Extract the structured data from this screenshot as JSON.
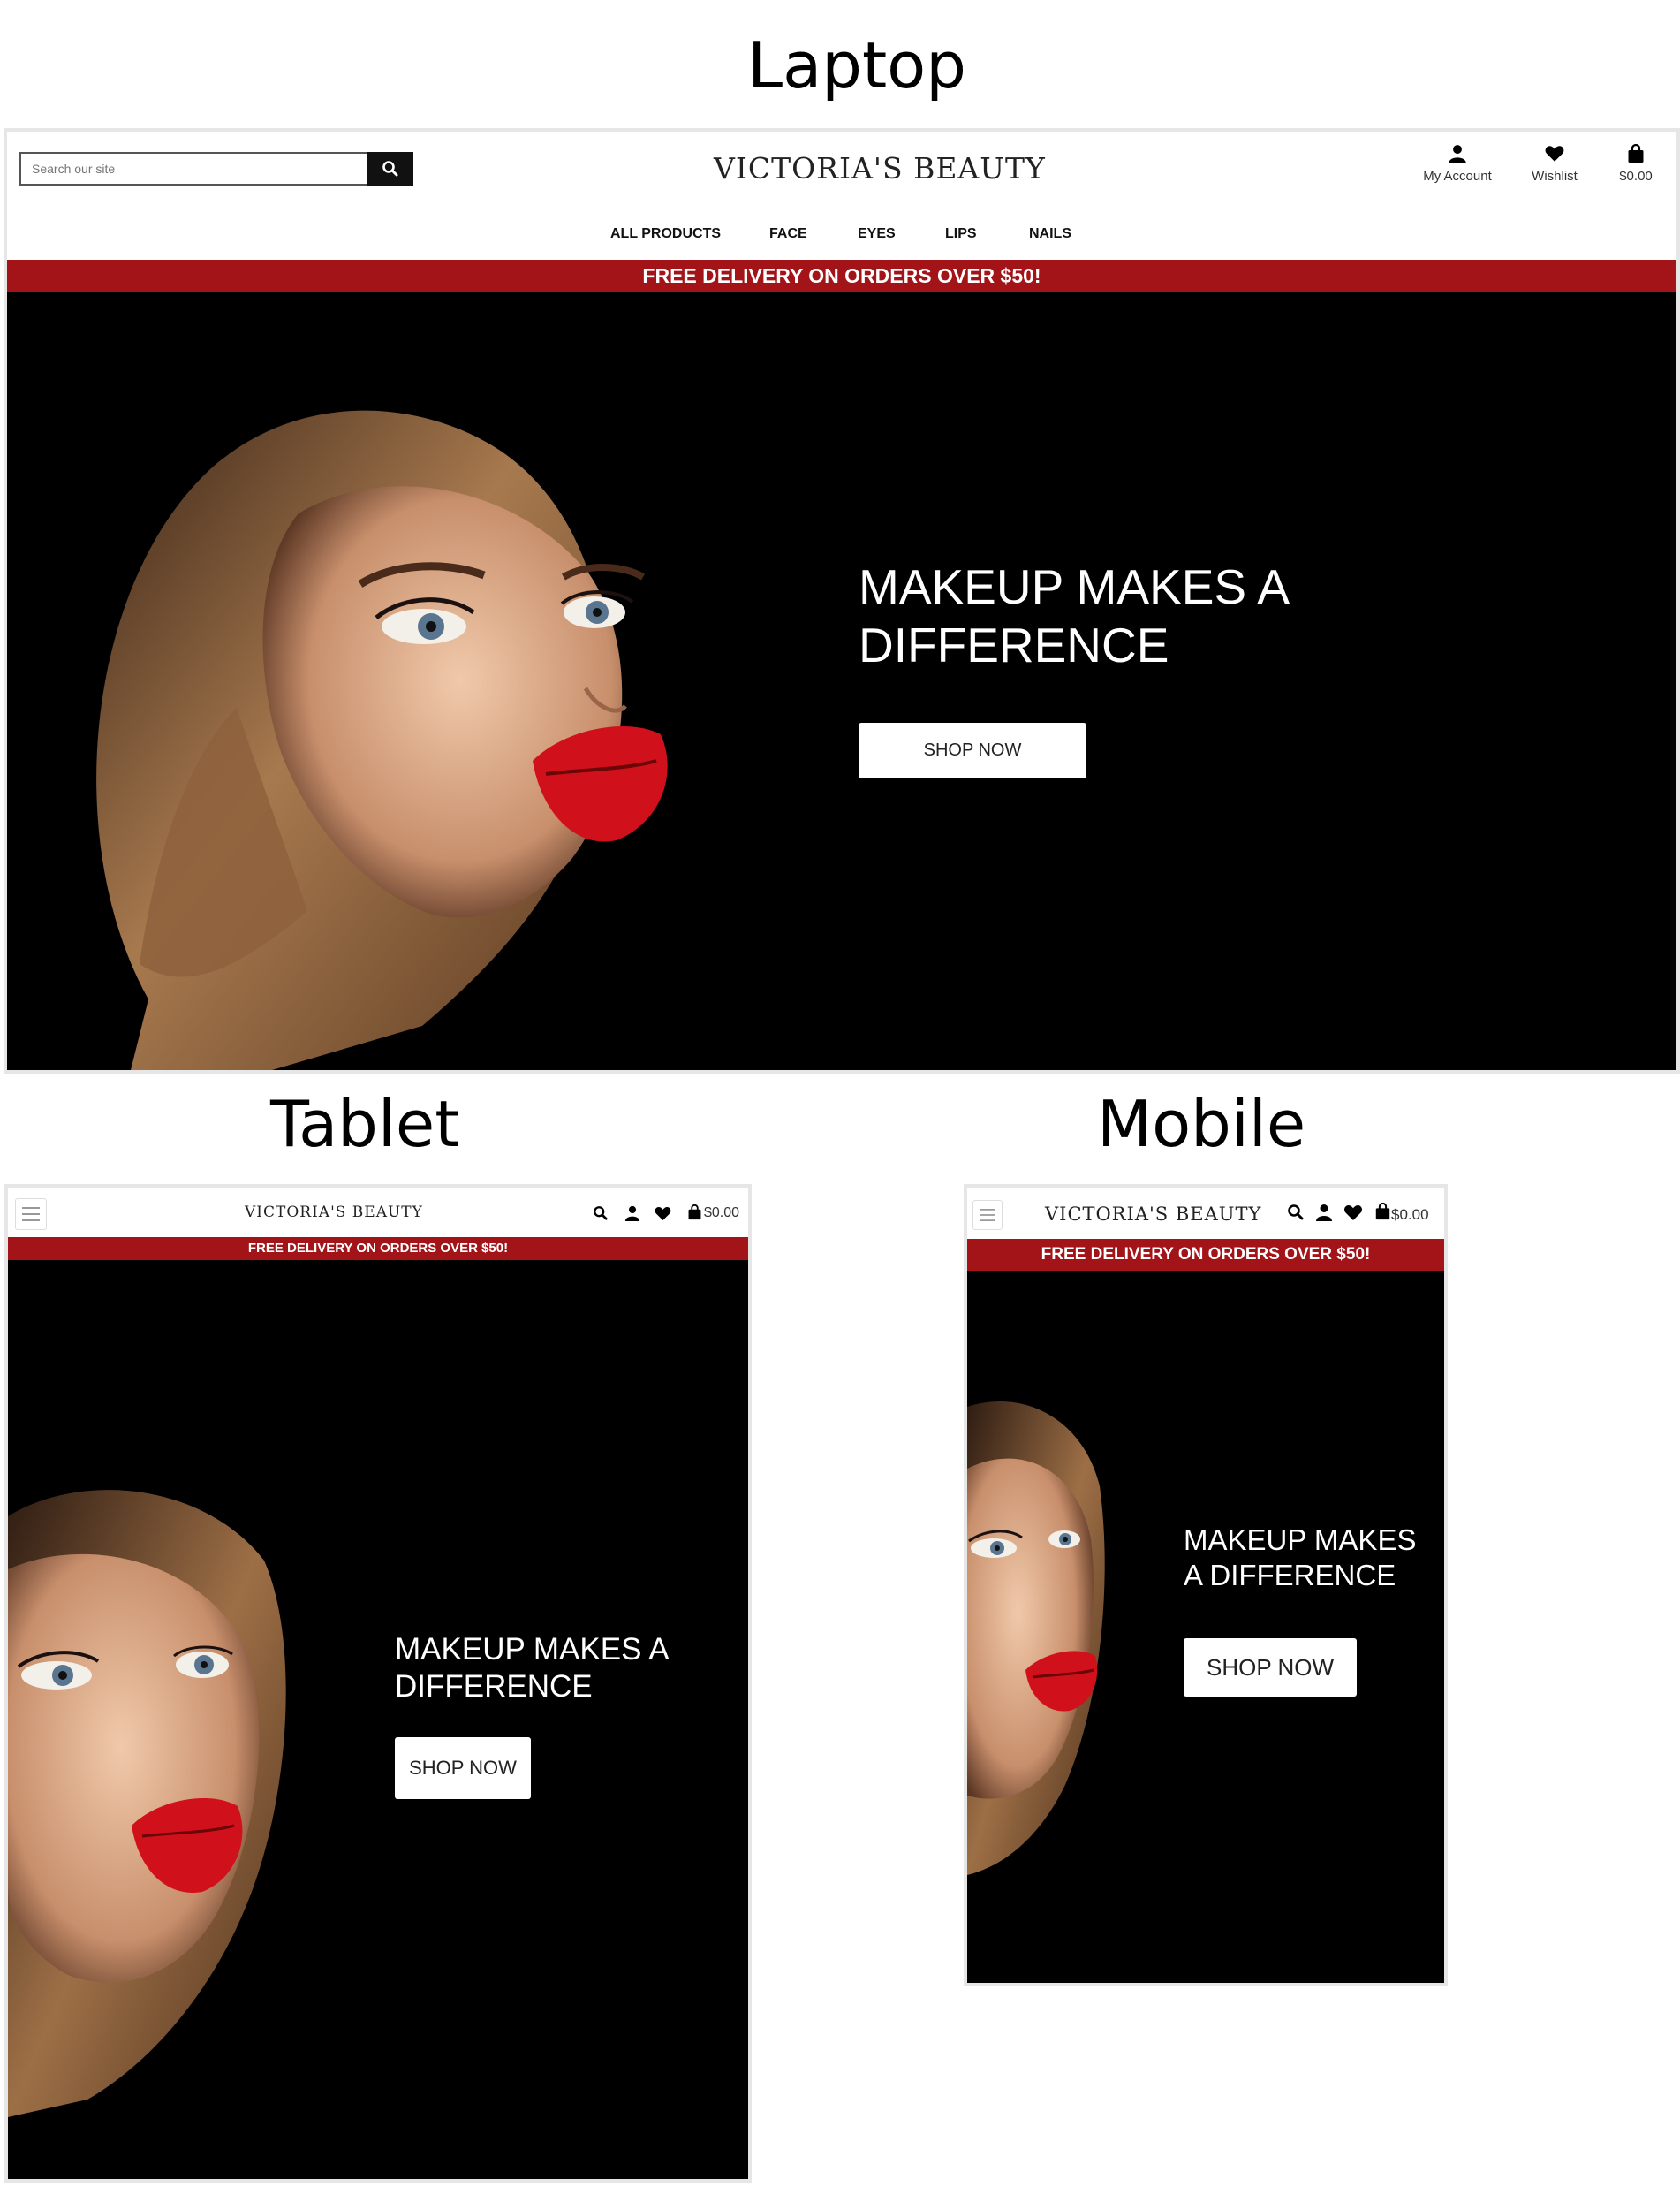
{
  "sections": {
    "laptop": "Laptop",
    "tablet": "Tablet",
    "mobile": "Mobile"
  },
  "colors": {
    "accent_red": "#a31418",
    "hero_bg": "#000000",
    "lips": "#d0101a",
    "hair": "#8a5a33"
  },
  "site": {
    "brand": "VICTORIA'S BEAUTY",
    "banner": "FREE DELIVERY ON ORDERS OVER $50!",
    "hero_title_line1": "MAKEUP MAKES A",
    "hero_title_line2": "DIFFERENCE",
    "mobile_title_line1": "MAKEUP MAKES",
    "mobile_title_line2": "A DIFFERENCE",
    "cta": "SHOP NOW",
    "search_placeholder": "Search our site",
    "account_label": "My Account",
    "wishlist_label": "Wishlist",
    "cart_total": "$0.00",
    "nav": [
      "ALL PRODUCTS",
      "FACE",
      "EYES",
      "LIPS",
      "NAILS"
    ]
  },
  "icons": [
    "search-icon",
    "user-icon",
    "heart-icon",
    "shopping-bag-icon",
    "hamburger-menu-icon"
  ]
}
